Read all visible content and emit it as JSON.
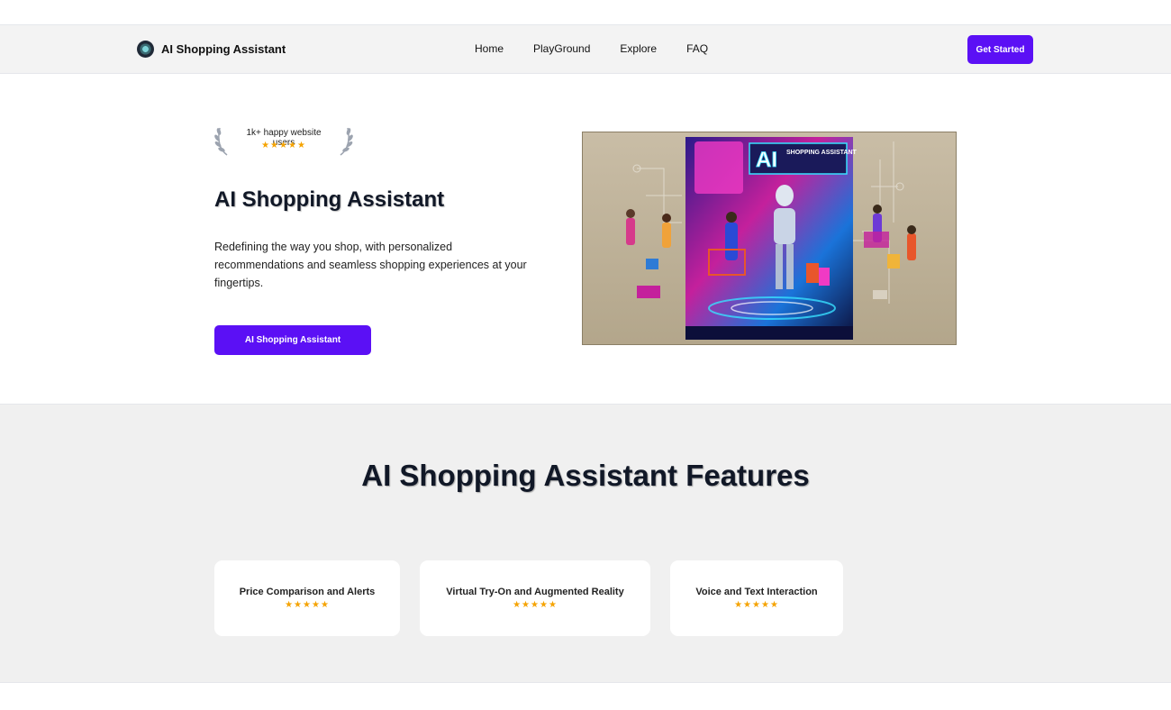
{
  "navbar": {
    "brand": "AI Shopping Assistant",
    "links": [
      "Home",
      "PlayGround",
      "Explore",
      "FAQ"
    ],
    "cta": "Get Started"
  },
  "hero": {
    "badge_text": "1k+ happy website users",
    "badge_stars": "★★★★★",
    "title": "AI Shopping Assistant",
    "description": "Redefining the way you shop, with personalized recommendations and seamless shopping experiences at your fingertips.",
    "button": "AI Shopping Assistant",
    "image": {
      "poster_title": "AI",
      "poster_subtitle": "SHOPPING ASSISTANT"
    }
  },
  "features": {
    "title": "AI Shopping Assistant Features",
    "cards": [
      {
        "title": "Price Comparison and Alerts",
        "stars": "★★★★★"
      },
      {
        "title": "Virtual Try-On and Augmented Reality",
        "stars": "★★★★★"
      },
      {
        "title": "Voice and Text Interaction",
        "stars": "★★★★★"
      }
    ]
  },
  "colors": {
    "accent": "#5b10f5",
    "star": "#f5a300",
    "section_bg": "#f0f0f0"
  }
}
